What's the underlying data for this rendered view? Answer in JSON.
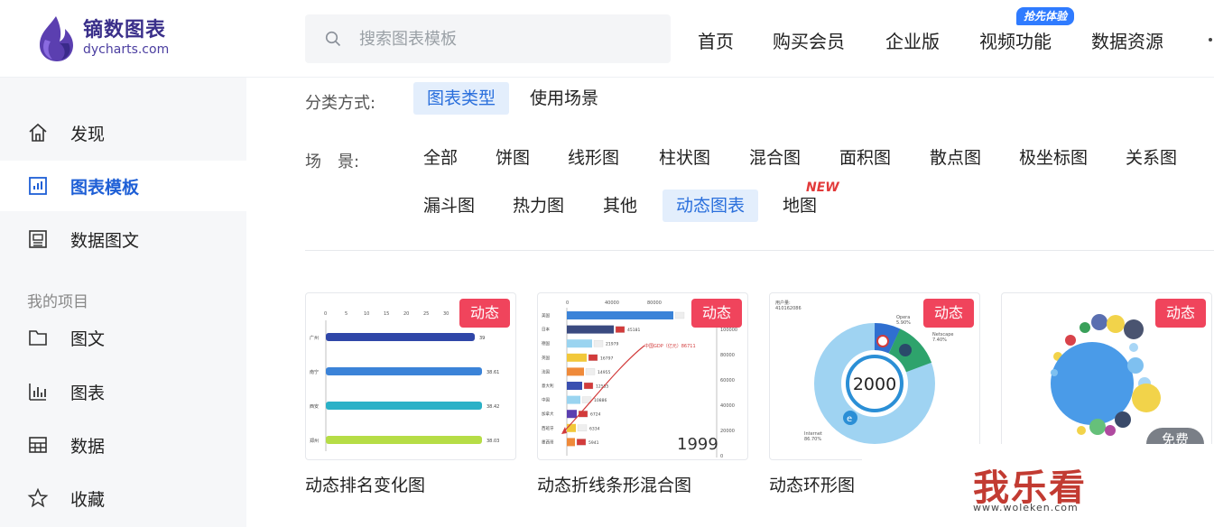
{
  "header": {
    "logo_cn": "镝数图表",
    "logo_en": "dycharts.com",
    "search_placeholder": "搜索图表模板",
    "nav": [
      "首页",
      "购买会员",
      "企业版",
      "视频功能",
      "数据资源"
    ],
    "promo_badge": "抢先体验"
  },
  "sidebar": {
    "items": [
      {
        "label": "发现",
        "icon": "home-icon"
      },
      {
        "label": "图表模板",
        "icon": "chart-template-icon",
        "active": true
      },
      {
        "label": "数据图文",
        "icon": "article-icon"
      }
    ],
    "section_title": "我的项目",
    "project_items": [
      {
        "label": "图文",
        "icon": "folder-icon"
      },
      {
        "label": "图表",
        "icon": "bar-chart-icon"
      },
      {
        "label": "数据",
        "icon": "table-icon"
      },
      {
        "label": "收藏",
        "icon": "star-icon"
      }
    ]
  },
  "filters": {
    "sort_label": "分类方式:",
    "sort_options": [
      "图表类型",
      "使用场景"
    ],
    "sort_selected": "图表类型",
    "scene_label": "场　景:",
    "scene_options": [
      "全部",
      "饼图",
      "线形图",
      "柱状图",
      "混合图",
      "面积图",
      "散点图",
      "极坐标图",
      "关系图",
      "漏斗图",
      "热力图",
      "其他",
      "动态图表",
      "地图"
    ],
    "scene_selected": "动态图表",
    "new_badge": "NEW"
  },
  "cards": [
    {
      "title": "动态排名变化图",
      "tag": "动态"
    },
    {
      "title": "动态折线条形混合图",
      "tag": "动态"
    },
    {
      "title": "动态环形图",
      "tag": "动态"
    },
    {
      "title": "",
      "tag": "动态",
      "extra_badge": "免费"
    }
  ],
  "thumbs": {
    "rank": {
      "axis": [
        "0",
        "5",
        "10",
        "15",
        "20",
        "25",
        "30"
      ],
      "rows": [
        {
          "label": "广州",
          "value": "39"
        },
        {
          "label": "南宁",
          "value": "38.61"
        },
        {
          "label": "西安",
          "value": "38.42"
        },
        {
          "label": "郑州",
          "value": "38.03"
        }
      ]
    },
    "mixed": {
      "top_axis": [
        "0",
        "40000",
        "80000"
      ],
      "right_axis": [
        "100000",
        "80000",
        "60000",
        "40000",
        "20000",
        "0"
      ],
      "rows": [
        {
          "label": "美国",
          "value": ""
        },
        {
          "label": "日本",
          "value": "45181"
        },
        {
          "label": "德国",
          "value": "21979"
        },
        {
          "label": "英国",
          "value": "16797"
        },
        {
          "label": "法国",
          "value": "14955"
        },
        {
          "label": "意大利",
          "value": "12535"
        },
        {
          "label": "中国",
          "value": "10886"
        },
        {
          "label": "加拿大",
          "value": "6724"
        },
        {
          "label": "西班牙",
          "value": "6334"
        },
        {
          "label": "墨西哥",
          "value": "5941"
        }
      ],
      "gdp_label": "中国GDP（亿元）86711",
      "year": "1999"
    },
    "ring": {
      "user_label": "用户量:",
      "user_value": "410162086",
      "center": "2000",
      "opera": "Opera",
      "opera_pct": "5.90%",
      "netscape": "Netscape",
      "netscape_pct": "7.40%",
      "internet": "Internet",
      "internet_pct": "86.70%"
    }
  },
  "watermark": {
    "cn": "我乐看",
    "url": "www.woleken.com"
  },
  "colors": {
    "accent": "#2a6fdc",
    "tag_red": "#f0445c",
    "sidebar_bg": "#f6f7f9"
  }
}
